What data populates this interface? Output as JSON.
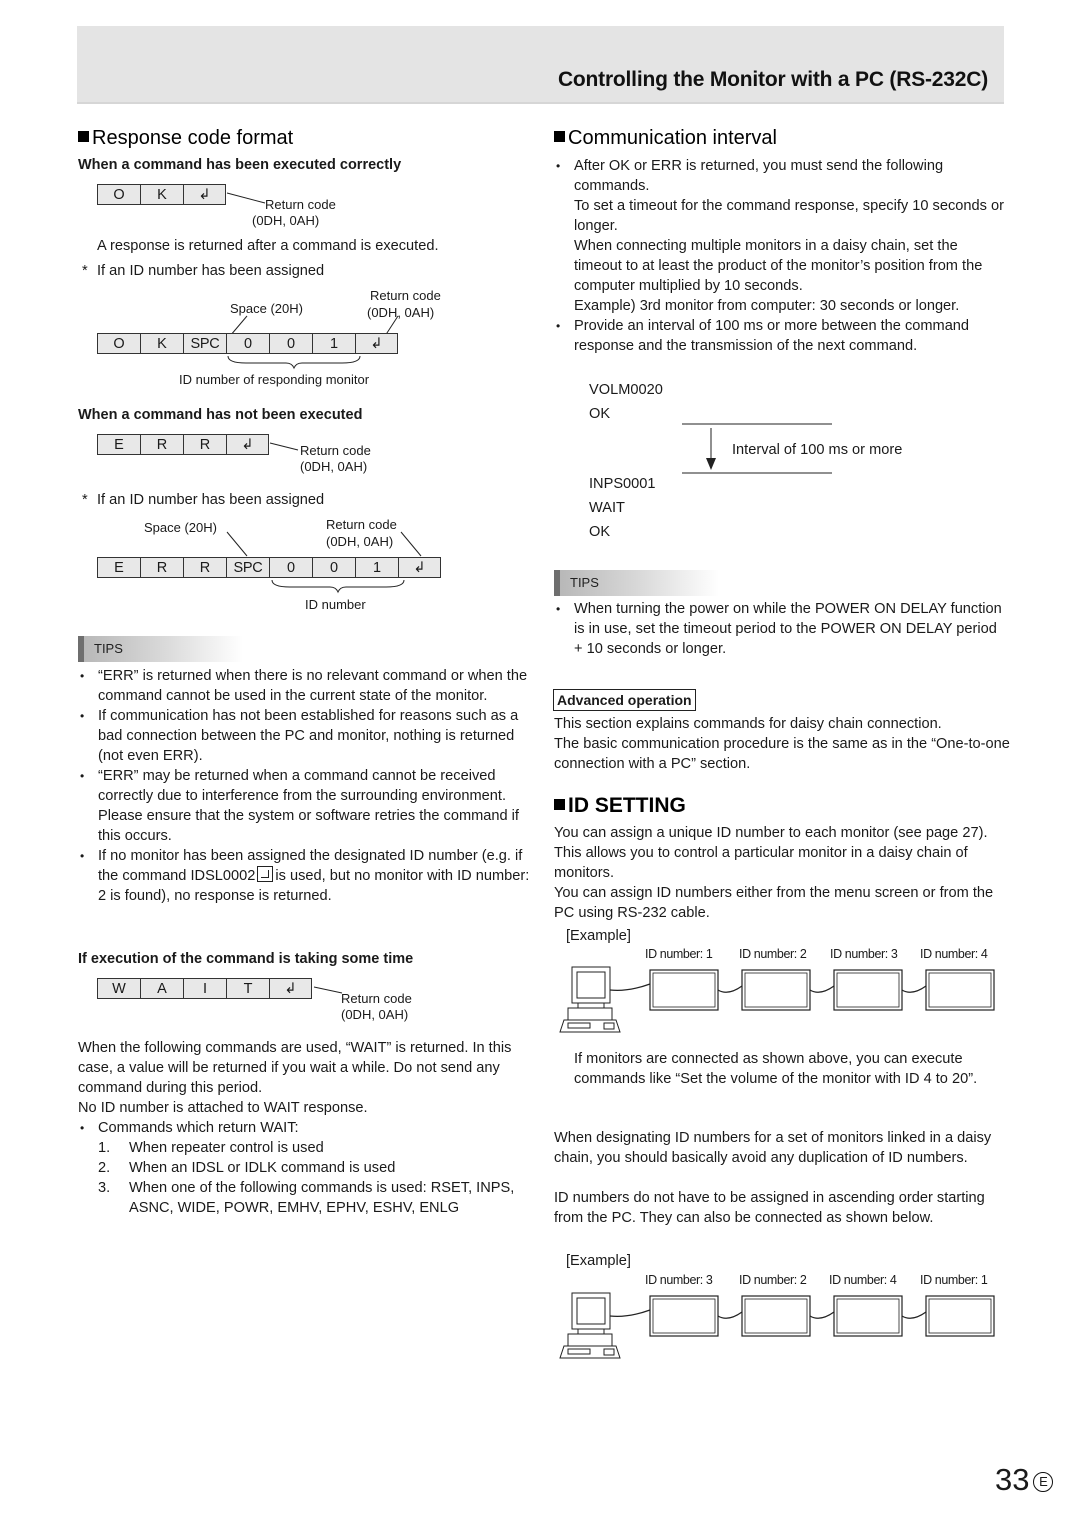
{
  "header": {
    "title": "Controlling the Monitor with a PC (RS-232C)"
  },
  "left": {
    "heading": "Response code format",
    "executed": {
      "subheading": "When a command has been executed correctly",
      "cells": [
        "O",
        "K",
        "↲"
      ],
      "return_code_label": "Return code",
      "return_code_hex": "(0DH, 0AH)",
      "description": "A response is returned after a command is executed.",
      "id_note_mark": "*",
      "id_note": "If an ID number has been assigned",
      "space_label": "Space (20H)",
      "id_cells": [
        "O",
        "K",
        "SPC",
        "0",
        "0",
        "1",
        "↲"
      ],
      "id_brace_label": "ID number of responding monitor"
    },
    "not_executed": {
      "subheading": "When a command has not been executed",
      "cells": [
        "E",
        "R",
        "R",
        "↲"
      ],
      "return_code_label": "Return code",
      "return_code_hex": "(0DH, 0AH)",
      "id_note_mark": "*",
      "id_note": "If an ID number has been assigned",
      "space_label": "Space (20H)",
      "id_cells": [
        "E",
        "R",
        "R",
        "SPC",
        "0",
        "0",
        "1",
        "↲"
      ],
      "id_brace_label": "ID number"
    },
    "tips": {
      "label": "TIPS",
      "items": [
        "“ERR” is returned when there is no relevant command or when the command cannot be used in the current state of the monitor.",
        "If communication has not been established for reasons such as a bad connection between the PC and monitor, nothing is returned (not even ERR).",
        "“ERR” may be returned when a command cannot be received correctly due to interference from the surrounding environment.",
        "Please ensure that the system or software retries the command if this occurs.",
        "If no monitor has been assigned the designated ID number (e.g. if the command IDSL0002",
        "is used, but no monitor with ID number: 2 is found), no response is returned."
      ]
    },
    "wait": {
      "subheading": "If execution of the command is taking some time",
      "cells": [
        "W",
        "A",
        "I",
        "T",
        "↲"
      ],
      "return_code_label": "Return code",
      "return_code_hex": "(0DH, 0AH)",
      "para1": "When the following commands are used, “WAIT” is returned. In this case, a value will be returned if you wait a while. Do not send any command during this period.",
      "para2": "No ID number is attached to WAIT response.",
      "bullet": "Commands which return WAIT:",
      "list": [
        {
          "n": "1.",
          "text": "When repeater control is used"
        },
        {
          "n": "2.",
          "text": "When an IDSL or IDLK command is used"
        },
        {
          "n": "3.",
          "text": "When one of the following commands is used: RSET, INPS, ASNC, WIDE, POWR, EMHV, EPHV, ESHV, ENLG"
        }
      ]
    }
  },
  "right": {
    "heading": "Communication interval",
    "bullet1": [
      "After OK or ERR is returned, you must send the following commands.",
      "To set a timeout for the command response, specify 10 seconds or longer.",
      "When connecting multiple monitors in a daisy chain, set the timeout to at least the product of the monitor’s position from the computer multiplied by 10 seconds.",
      "Example) 3rd monitor from computer: 30 seconds or longer."
    ],
    "bullet2": "Provide an interval of 100 ms or more between the command response and the transmission of the next command.",
    "sequence_before": [
      "VOLM0020",
      "OK"
    ],
    "interval_label": "Interval of 100 ms or more",
    "sequence_after": [
      "INPS0001",
      "WAIT",
      "OK"
    ],
    "tips": {
      "label": "TIPS",
      "items": [
        "When turning the power on while the POWER ON DELAY function is in use, set the timeout period to the POWER ON DELAY period + 10 seconds or longer."
      ]
    },
    "advanced": {
      "label": "Advanced operation",
      "text1": "This section explains commands for daisy chain connection.",
      "text2": "The basic communication procedure is the same as in the “One-to-one connection with a PC” section."
    },
    "id_setting": {
      "heading": "ID SETTING",
      "para1": "You can assign a unique ID number to each monitor (see page 27). This allows you to control a particular monitor in a daisy chain of monitors.",
      "para2": "You can assign ID numbers either from the menu screen or from the PC using RS-232 cable.",
      "example_label": "[Example]",
      "example1_ids": [
        "ID number: 1",
        "ID number: 2",
        "ID number: 3",
        "ID number: 4"
      ],
      "example1_note": "If monitors are connected as shown above, you can execute commands like “Set the volume of the monitor with ID 4 to 20”.",
      "para3": "When designating ID numbers for a set of monitors linked in a daisy chain, you should basically avoid any duplication of ID numbers.",
      "para4": "ID numbers do not have to be assigned in ascending order starting from the PC. They can also be connected as shown below.",
      "example2_label": "[Example]",
      "example2_ids": [
        "ID number: 3",
        "ID number: 2",
        "ID number: 4",
        "ID number: 1"
      ]
    }
  },
  "footer": {
    "page_number": "33",
    "language_mark": "E"
  }
}
